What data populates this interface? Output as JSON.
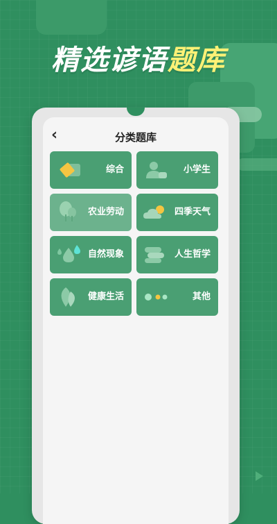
{
  "headline": {
    "normal": "精选谚语",
    "highlight": "题库"
  },
  "header": {
    "back_glyph": "‹",
    "title": "分类题库"
  },
  "categories": [
    {
      "label": "综合",
      "icon": "yellow-square-icon"
    },
    {
      "label": "小学生",
      "icon": "person-icon"
    },
    {
      "label": "农业劳动",
      "icon": "tree-icon"
    },
    {
      "label": "四季天气",
      "icon": "sun-cloud-icon"
    },
    {
      "label": "自然现象",
      "icon": "water-drops-icon"
    },
    {
      "label": "人生哲学",
      "icon": "book-stack-icon"
    },
    {
      "label": "健康生活",
      "icon": "leaf-icon"
    },
    {
      "label": "其他",
      "icon": "dots-icon"
    }
  ],
  "colors": {
    "background": "#2f8f5f",
    "card": "#4a9f73",
    "card_light": "#6cb28d",
    "highlight": "#fff176"
  }
}
